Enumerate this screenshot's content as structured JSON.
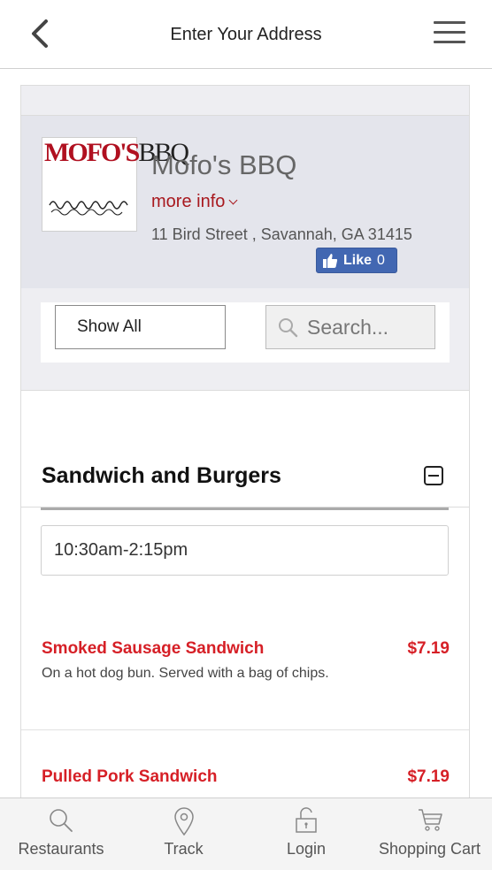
{
  "header": {
    "title": "Enter Your Address"
  },
  "restaurant": {
    "logo_text_red": "MOFO'S",
    "logo_text_black": "BBQ",
    "name": "Mofo's BBQ",
    "more_info": "more info",
    "address": "11 Bird Street , Savannah, GA 31415",
    "fb_like_label": "Like",
    "fb_like_count": "0"
  },
  "filters": {
    "show_all": "Show All",
    "search_placeholder": "Search..."
  },
  "menu_section": {
    "title": "Sandwich and Burgers",
    "hours": "10:30am-2:15pm",
    "items": [
      {
        "name": "Smoked Sausage Sandwich",
        "price": "$7.19",
        "description": "On a hot dog bun. Served with a bag of chips."
      },
      {
        "name": "Pulled Pork Sandwich",
        "price": "$7.19",
        "description": ""
      }
    ]
  },
  "bottom_nav": [
    {
      "label": "Restaurants",
      "icon": "search-icon"
    },
    {
      "label": "Track",
      "icon": "location-pin-icon"
    },
    {
      "label": "Login",
      "icon": "lock-icon"
    },
    {
      "label": "Shopping Cart",
      "icon": "cart-icon"
    }
  ],
  "colors": {
    "accent_red": "#d61f26",
    "link_red": "#a8181e",
    "facebook_blue": "#4267b2",
    "info_bg": "#e4e5ec"
  }
}
